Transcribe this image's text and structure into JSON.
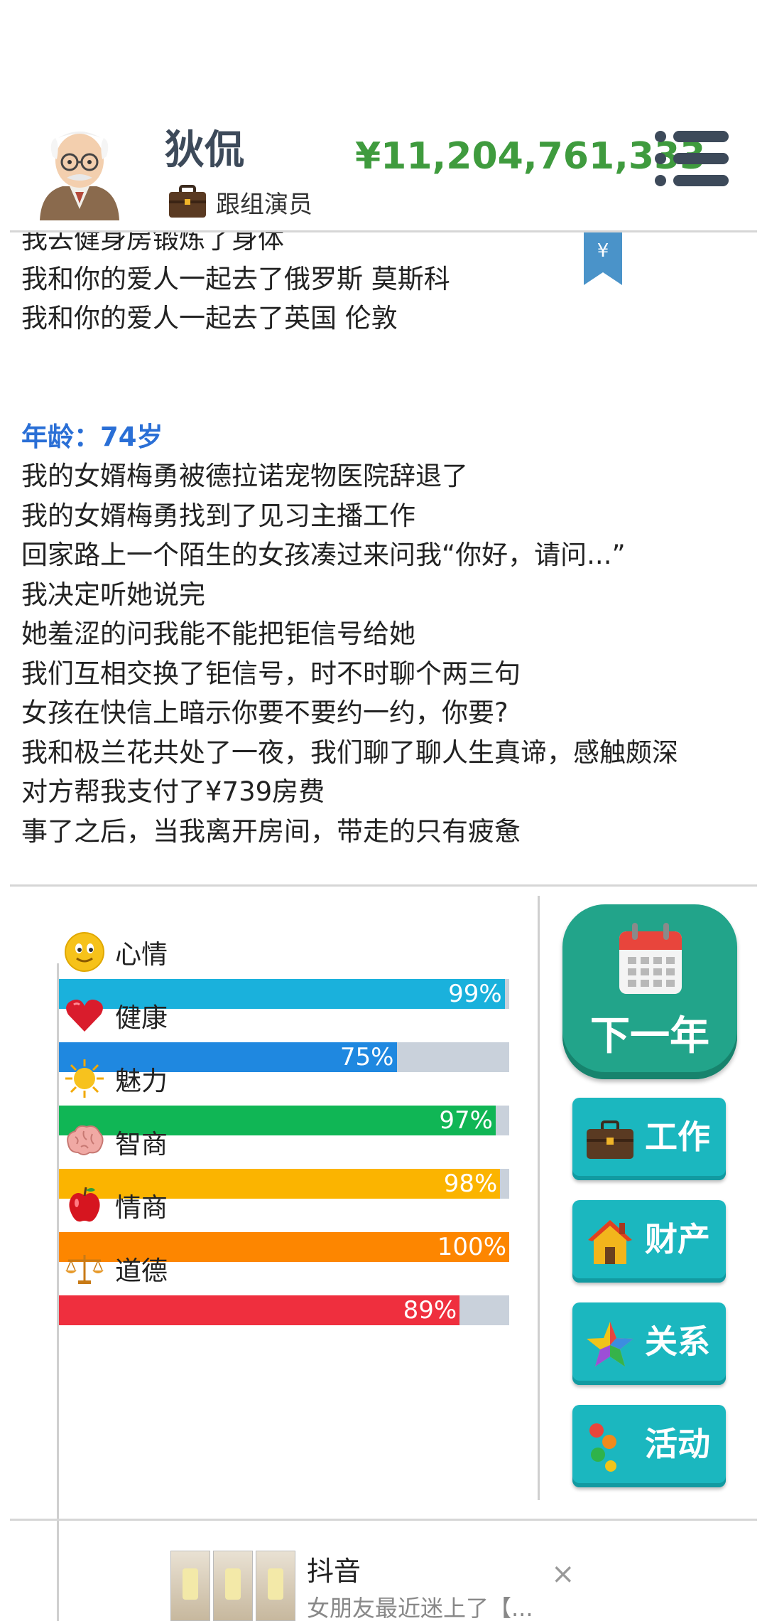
{
  "header": {
    "name": "狄侃",
    "job": "跟组演员",
    "money": "¥11,204,761,333"
  },
  "log": {
    "lines_before_age": [
      "我去健身房锻炼了身体",
      "我和你的爱人一起去了俄罗斯 莫斯科",
      "我和你的爱人一起去了英国 伦敦"
    ],
    "age_label": "年龄：74岁",
    "lines_after_age": [
      "我的女婿梅勇被德拉诺宠物医院辞退了",
      "我的女婿梅勇找到了见习主播工作",
      "回家路上一个陌生的女孩凑过来问我“你好，请问...”",
      "我决定听她说完",
      "她羞涩的问我能不能把钜信号给她",
      "我们互相交换了钜信号，时不时聊个两三句",
      "女孩在快信上暗示你要不要约一约，你要?",
      "我和极兰花共处了一夜，我们聊了聊人生真谛，感触颇深",
      "对方帮我支付了¥739房费",
      "事了之后，当我离开房间，带走的只有疲惫"
    ]
  },
  "stats": [
    {
      "label": "心情",
      "value": 99,
      "display": "99%",
      "color": "#1ab1dc",
      "icon": "smiley-icon"
    },
    {
      "label": "健康",
      "value": 75,
      "display": "75%",
      "color": "#1f88e0",
      "icon": "heart-icon"
    },
    {
      "label": "魅力",
      "value": 97,
      "display": "97%",
      "color": "#10b655",
      "icon": "sun-icon"
    },
    {
      "label": "智商",
      "value": 98,
      "display": "98%",
      "color": "#fbb400",
      "icon": "brain-icon"
    },
    {
      "label": "情商",
      "value": 100,
      "display": "100%",
      "color": "#fd8600",
      "icon": "apple-icon"
    },
    {
      "label": "道德",
      "value": 89,
      "display": "89%",
      "color": "#ef2f3e",
      "icon": "scales-icon"
    }
  ],
  "actions": {
    "next_year": "下一年",
    "buttons": [
      {
        "label": "工作",
        "icon": "briefcase-icon"
      },
      {
        "label": "财产",
        "icon": "house-icon"
      },
      {
        "label": "关系",
        "icon": "star-icon"
      },
      {
        "label": "活动",
        "icon": "activity-icon"
      }
    ]
  },
  "ad": {
    "title": "抖音",
    "description": "女朋友最近迷上了【...",
    "close": "×"
  },
  "colors": {
    "money": "#3f9b3e",
    "age": "#2a6fd6",
    "next_year_bg": "#22a48a",
    "side_button_bg": "#1bb7bf"
  }
}
